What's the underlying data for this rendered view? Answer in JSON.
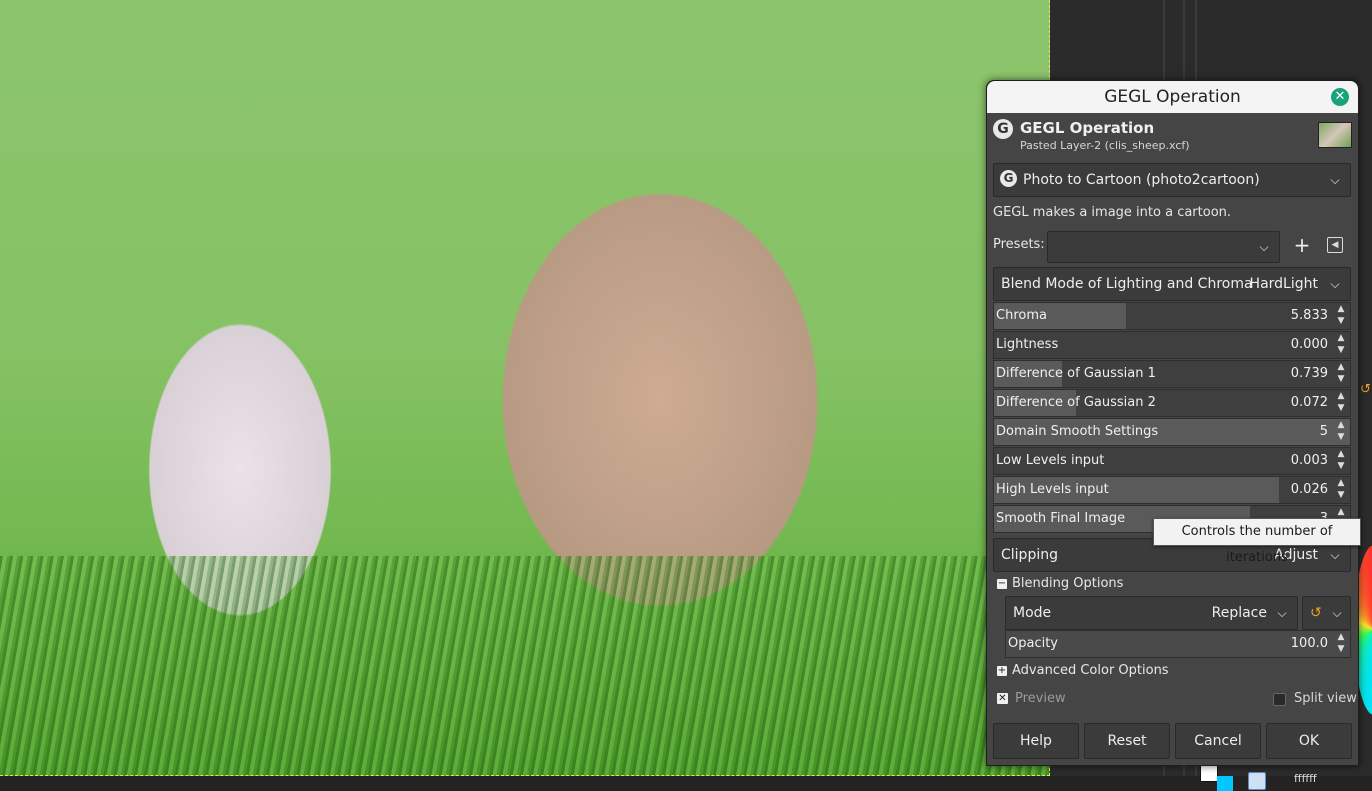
{
  "dialog": {
    "window_title": "GEGL Operation",
    "header_title": "GEGL Operation",
    "header_subtitle": "Pasted Layer-2 (clis_sheep.xcf)",
    "operation": "Photo to Cartoon (photo2cartoon)",
    "operation_description": "GEGL makes a image into a cartoon.",
    "presets_label": "Presets:",
    "presets_value": "",
    "blend_mode": {
      "label": "Blend Mode of Lighting and Chroma",
      "value": "HardLight"
    },
    "parameters": [
      {
        "label": "Chroma",
        "value": "5.833",
        "fill_fraction": 0.37
      },
      {
        "label": "Lightness",
        "value": "0.000",
        "fill_fraction": 0.0
      },
      {
        "label": "Difference of Gaussian 1",
        "value": "0.739",
        "fill_fraction": 0.19
      },
      {
        "label": "Difference of Gaussian 2",
        "value": "0.072",
        "fill_fraction": 0.23
      },
      {
        "label": "Domain Smooth Settings",
        "value": "5",
        "fill_fraction": 1.0
      },
      {
        "label": "Low Levels input",
        "value": "0.003",
        "fill_fraction": 0.0
      },
      {
        "label": "High Levels input",
        "value": "0.026",
        "fill_fraction": 0.8
      },
      {
        "label": "Smooth Final Image",
        "value": "3",
        "fill_fraction": 0.72
      }
    ],
    "clipping": {
      "label": "Clipping",
      "value": "Adjust"
    },
    "blending_options": {
      "label": "Blending Options",
      "mode_label": "Mode",
      "mode_value": "Replace",
      "opacity_label": "Opacity",
      "opacity_value": "100.0"
    },
    "advanced_color_options": "Advanced Color Options",
    "preview_label": "Preview",
    "split_view_label": "Split view",
    "buttons": {
      "help": "Help",
      "reset": "Reset",
      "cancel": "Cancel",
      "ok": "OK"
    }
  },
  "tooltip": "Controls the number of iterations",
  "statusbar": {
    "hex_color": "ffffff"
  },
  "icons": {
    "close": "close-icon",
    "gegl_logo": "gegl-logo-icon",
    "chevron": "chevron-down-icon",
    "add": "plus-icon",
    "menu": "presets-menu-icon",
    "reset": "reset-icon"
  },
  "colors": {
    "accent_close": "#1aa37a",
    "reset_icon": "#f0a020"
  }
}
